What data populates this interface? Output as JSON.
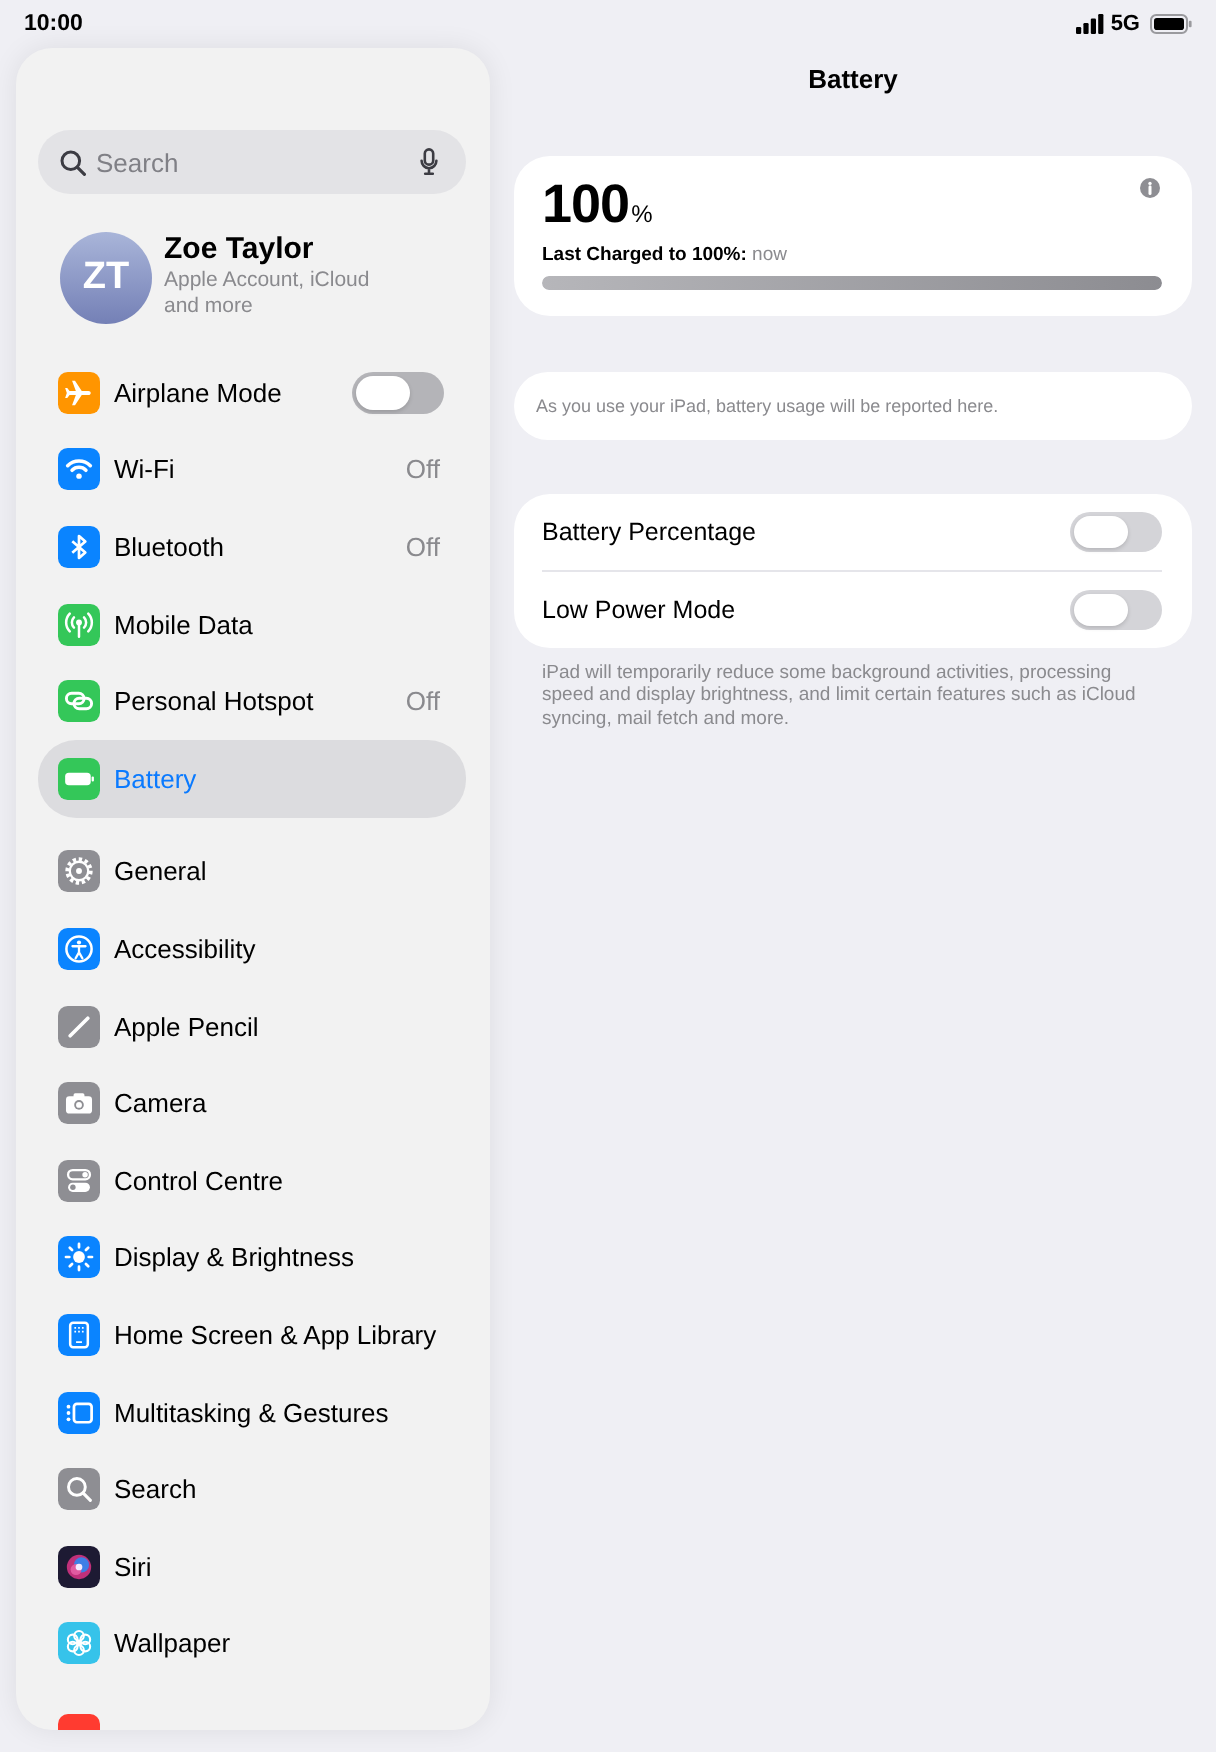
{
  "status_bar": {
    "time": "10:00",
    "network": "5G"
  },
  "sidebar": {
    "search": {
      "placeholder": "Search"
    },
    "account": {
      "initials": "ZT",
      "name": "Zoe Taylor",
      "subtitle": "Apple Account, iCloud and more"
    },
    "groups": [
      {
        "items": [
          {
            "label": "Airplane Mode",
            "kind": "toggle",
            "on": false,
            "selected": false
          },
          {
            "label": "Wi-Fi",
            "kind": "value",
            "value": "Off",
            "selected": false
          },
          {
            "label": "Bluetooth",
            "kind": "value",
            "value": "Off",
            "selected": false
          },
          {
            "label": "Mobile Data",
            "kind": "link",
            "selected": false
          },
          {
            "label": "Personal Hotspot",
            "kind": "value",
            "value": "Off",
            "selected": false
          },
          {
            "label": "Battery",
            "kind": "link",
            "selected": true
          }
        ]
      },
      {
        "items": [
          {
            "label": "General",
            "kind": "link",
            "selected": false
          },
          {
            "label": "Accessibility",
            "kind": "link",
            "selected": false
          },
          {
            "label": "Apple Pencil",
            "kind": "link",
            "selected": false
          },
          {
            "label": "Camera",
            "kind": "link",
            "selected": false
          },
          {
            "label": "Control Centre",
            "kind": "link",
            "selected": false
          },
          {
            "label": "Display & Brightness",
            "kind": "link",
            "selected": false
          },
          {
            "label": "Home Screen & App Library",
            "kind": "link",
            "selected": false
          },
          {
            "label": "Multitasking & Gestures",
            "kind": "link",
            "selected": false
          },
          {
            "label": "Search",
            "kind": "link",
            "selected": false
          },
          {
            "label": "Siri",
            "kind": "link",
            "selected": false
          },
          {
            "label": "Wallpaper",
            "kind": "link",
            "selected": false
          }
        ]
      }
    ]
  },
  "main": {
    "title": "Battery",
    "battery": {
      "percent": "100",
      "unit": "%",
      "last_charged": "**Last Charged to 100%:** now",
      "level": 1
    },
    "usage_note": "As you use your iPad, battery usage will be reported here.",
    "settings": [
      {
        "label": "Battery Percentage",
        "on": false
      },
      {
        "label": "Low Power Mode",
        "on": false
      }
    ],
    "footer": "iPad will temporarily reduce some background activities, processing speed and display brightness, and limit certain features such as iCloud syncing, mail fetch and more."
  }
}
